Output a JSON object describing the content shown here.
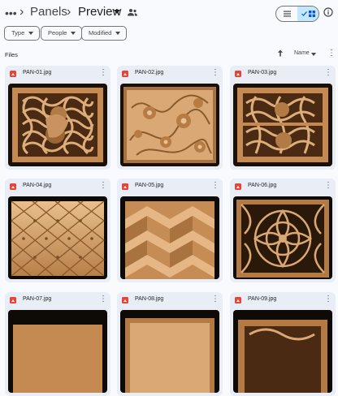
{
  "topbar": {
    "more_label": "•••",
    "breadcrumb_parent": "Panels",
    "breadcrumb_separator": "›",
    "breadcrumb_current": "Preview",
    "view_toggle": {
      "list_icon": "list-icon",
      "grid_icon": "grid-icon",
      "selected": "grid"
    }
  },
  "filters": [
    {
      "label": "Type"
    },
    {
      "label": "People"
    },
    {
      "label": "Modified"
    }
  ],
  "files_section": {
    "label": "Files",
    "sort_label": "Name",
    "sort_direction": "ascending"
  },
  "files": [
    {
      "name": "PAN-01.jpg"
    },
    {
      "name": "PAN-02.jpg"
    },
    {
      "name": "PAN-03.jpg"
    },
    {
      "name": "PAN-04.jpg"
    },
    {
      "name": "PAN-05.jpg"
    },
    {
      "name": "PAN-06.jpg"
    },
    {
      "name": "PAN-07.jpg"
    },
    {
      "name": "PAN-08.jpg"
    },
    {
      "name": "PAN-09.jpg"
    }
  ],
  "colors": {
    "accent": "#c2e7ff",
    "card_bg": "#e9eef6",
    "image_icon": "#ea4335",
    "wood_light": "#d9a874",
    "wood_dark": "#7a4e27"
  }
}
